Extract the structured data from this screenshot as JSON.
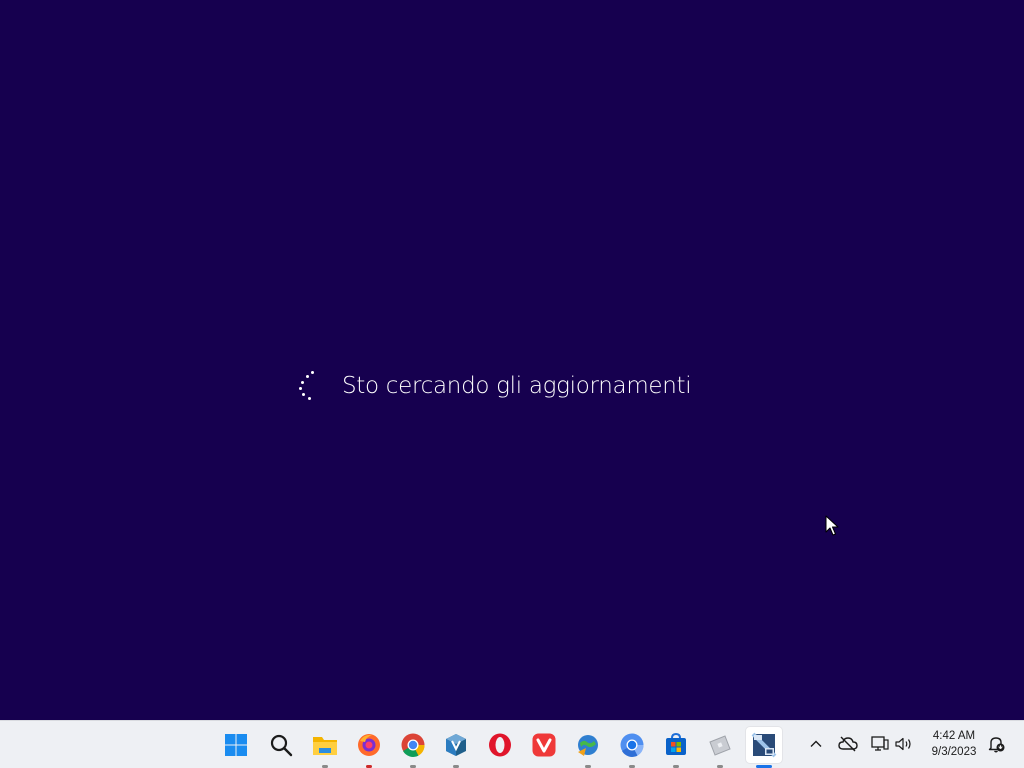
{
  "screen": {
    "background_color": "#16004f",
    "status_text": "Sto cercando gli aggiornamenti"
  },
  "taskbar": {
    "background_color": "#eef0f4",
    "apps": [
      {
        "name": "start-button",
        "icon": "windows-logo-icon"
      },
      {
        "name": "search-button",
        "icon": "search-icon"
      },
      {
        "name": "file-explorer",
        "icon": "folder-icon",
        "running": true
      },
      {
        "name": "firefox",
        "icon": "firefox-icon",
        "running": true
      },
      {
        "name": "chrome",
        "icon": "chrome-icon",
        "running": true
      },
      {
        "name": "virtualbox",
        "icon": "virtualbox-icon",
        "running": true
      },
      {
        "name": "opera",
        "icon": "opera-icon"
      },
      {
        "name": "vivaldi",
        "icon": "vivaldi-icon"
      },
      {
        "name": "internet-download-manager",
        "icon": "download-manager-icon",
        "running": true
      },
      {
        "name": "chromium",
        "icon": "chromium-icon",
        "running": true
      },
      {
        "name": "microsoft-store",
        "icon": "store-icon",
        "running": true
      },
      {
        "name": "roblox",
        "icon": "roblox-icon",
        "running": true
      },
      {
        "name": "cpu-z",
        "icon": "cpu-z-icon",
        "running": true,
        "active": true
      }
    ],
    "tray": {
      "icons": [
        "chevron-up-icon",
        "cloud-offline-icon",
        "network-icon",
        "volume-icon"
      ],
      "time": "4:42 AM",
      "date": "9/3/2023",
      "notification_icon": "notification-dnd-icon"
    }
  }
}
